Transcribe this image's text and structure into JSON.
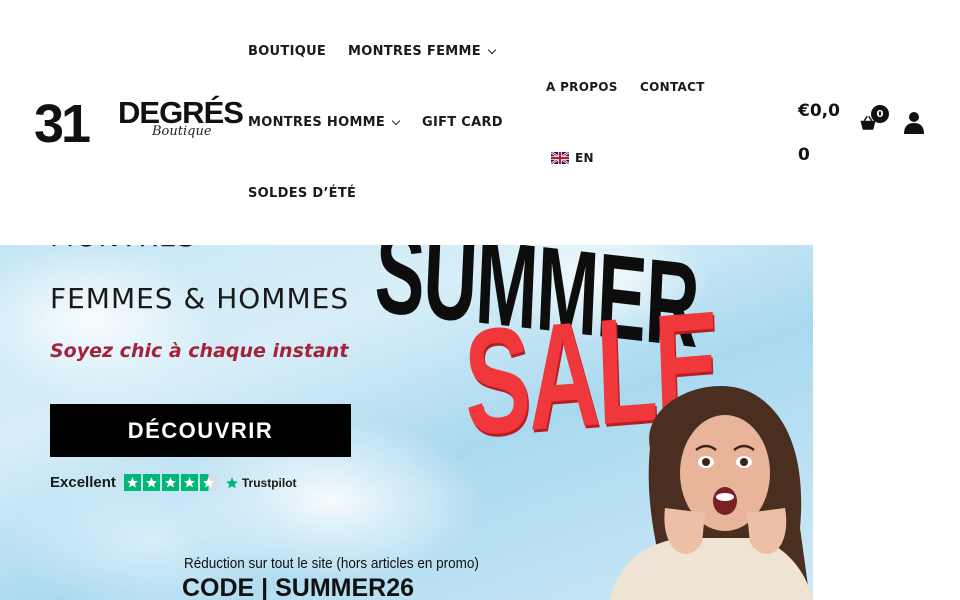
{
  "header": {
    "logo": {
      "number": "31",
      "word": "DEGRÉS",
      "script": "Boutique"
    },
    "nav": {
      "boutique": "BOUTIQUE",
      "montres_femme": "MONTRES FEMME",
      "montres_homme": "MONTRES HOMME",
      "gift_card": "GIFT CARD",
      "soldes": "SOLDES D’ÉTÉ",
      "a_propos": "A PROPOS",
      "contact": "CONTACT",
      "language": "EN"
    },
    "cart": {
      "total": "€0,00",
      "count": "0"
    },
    "icons": {
      "cart": "shopping-basket-icon",
      "account": "user-icon",
      "flag": "uk-flag-icon"
    }
  },
  "hero": {
    "kicker": "MONTRES",
    "title": "FEMMES & HOMMES",
    "tagline": "Soyez chic à chaque instant",
    "cta_label": "DÉCOUVRIR",
    "rating_label": "Excellent",
    "rating_stars": 4.5,
    "rating_brand": "Trustpilot",
    "banner_word_1": "SUMMER",
    "banner_word_2": "SALE",
    "promo_note": "Réduction sur tout le site (hors articles en promo)",
    "promo_code": "CODE | SUMMER26",
    "colors": {
      "tagline": "#a3233a",
      "sale": "#f0373c",
      "cta_bg": "#000000",
      "trustpilot_green": "#00b67a"
    }
  }
}
